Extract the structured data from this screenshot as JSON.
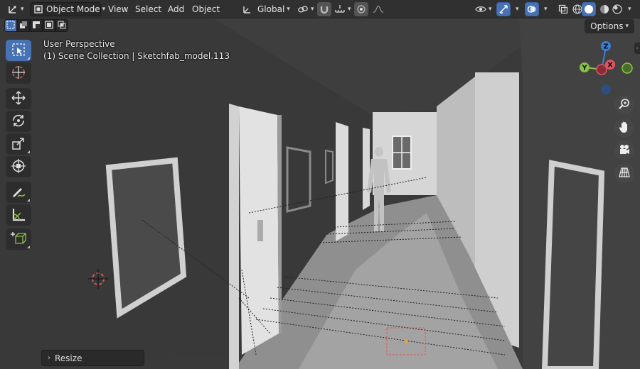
{
  "header": {
    "mode_label": "Object Mode",
    "menu": [
      "View",
      "Select",
      "Add",
      "Object"
    ],
    "transform_orientation": "Global",
    "options_label": "Options"
  },
  "viewport": {
    "perspective_label": "User Perspective",
    "collection_label": "(1) Scene Collection | Sketchfab_model.113"
  },
  "gizmo": {
    "z": "Z",
    "y": "Y",
    "x": "X"
  },
  "operator_panel": {
    "label": "Resize"
  },
  "toolbar": {
    "tools": [
      "select-box",
      "cursor",
      "move",
      "rotate",
      "scale",
      "transform",
      "annotate",
      "measure",
      "add-cube"
    ],
    "active": "select-box"
  },
  "colors": {
    "accent": "#4772b3",
    "axis_x": "#e05563",
    "axis_y": "#8ac14a",
    "axis_z": "#3a7fd4"
  }
}
